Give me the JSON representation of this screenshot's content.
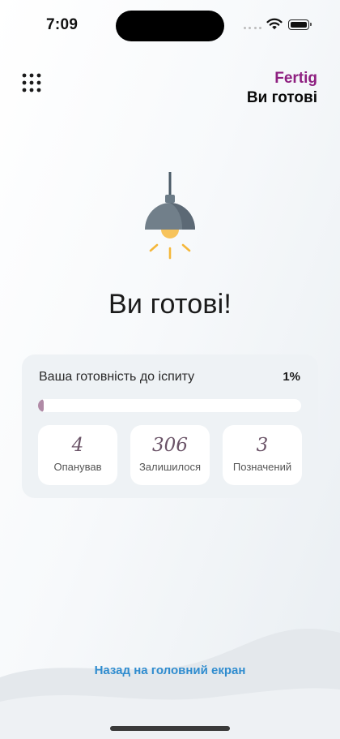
{
  "status_bar": {
    "time": "7:09"
  },
  "header": {
    "brand": "Fertig",
    "title": "Ви готові",
    "menu_icon": "grid-dots-icon"
  },
  "hero": {
    "icon": "pendant-lamp-icon",
    "heading": "Ви готові!"
  },
  "readiness": {
    "label": "Ваша готовність до іспиту",
    "percent_text": "1%",
    "progress": 0.01,
    "stats": [
      {
        "value": "4",
        "label": "Опанував"
      },
      {
        "value": "306",
        "label": "Залишилося"
      },
      {
        "value": "3",
        "label": "Позначений"
      }
    ]
  },
  "footer": {
    "back_link": "Назад на головний екран"
  },
  "colors": {
    "brand": "#8e1f80",
    "link": "#2f8ccf",
    "stat_value": "#6b5468",
    "progress_fill": "#b08aa6",
    "card_bg": "#eef2f5"
  }
}
